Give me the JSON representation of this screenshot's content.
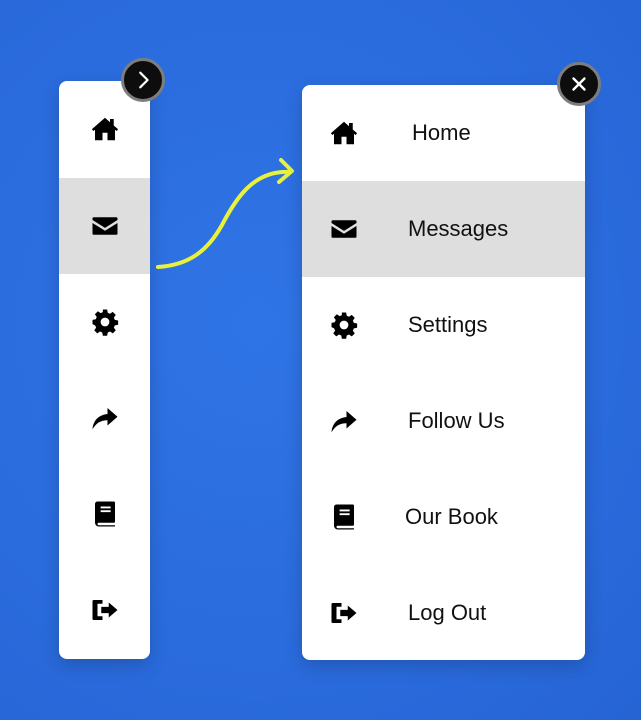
{
  "colors": {
    "background": "#2b6fe0",
    "panel": "#ffffff",
    "active": "#dedede",
    "accent_arrow": "#e9f23a"
  },
  "collapsed_sidebar": {
    "items": [
      {
        "icon": "home-icon"
      },
      {
        "icon": "envelope-icon",
        "active": true
      },
      {
        "icon": "gear-icon"
      },
      {
        "icon": "share-icon"
      },
      {
        "icon": "book-icon"
      },
      {
        "icon": "sign-out-icon"
      }
    ],
    "toggle_icon": "chevron-right-icon"
  },
  "expanded_sidebar": {
    "items": [
      {
        "icon": "home-icon",
        "label": "Home"
      },
      {
        "icon": "envelope-icon",
        "label": "Messages",
        "active": true
      },
      {
        "icon": "gear-icon",
        "label": "Settings"
      },
      {
        "icon": "share-icon",
        "label": "Follow Us"
      },
      {
        "icon": "book-icon",
        "label": "Our Book"
      },
      {
        "icon": "sign-out-icon",
        "label": "Log Out"
      }
    ],
    "toggle_icon": "close-icon"
  }
}
